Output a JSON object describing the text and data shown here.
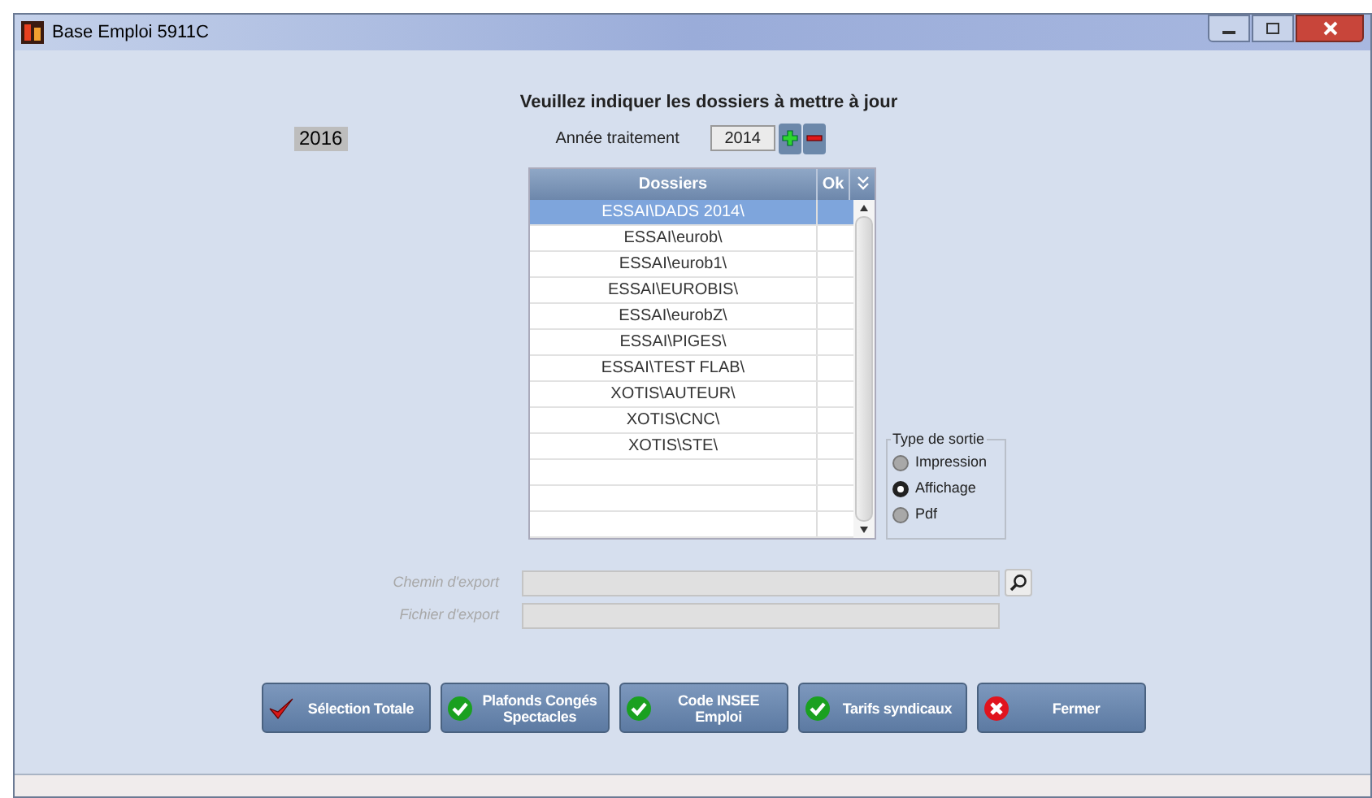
{
  "window": {
    "title": "Base Emploi 5911C"
  },
  "heading": "Veuillez indiquer les dossiers à mettre à jour",
  "year_badge": "2016",
  "year_field": {
    "label": "Année traitement",
    "value": "2014"
  },
  "table": {
    "columns": [
      "Dossiers",
      "Ok"
    ],
    "rows": [
      {
        "dossier": "ESSAI\\DADS 2014\\",
        "selected": true
      },
      {
        "dossier": "ESSAI\\eurob\\",
        "selected": false
      },
      {
        "dossier": "ESSAI\\eurob1\\",
        "selected": false
      },
      {
        "dossier": "ESSAI\\EUROBIS\\",
        "selected": false
      },
      {
        "dossier": "ESSAI\\eurobZ\\",
        "selected": false
      },
      {
        "dossier": "ESSAI\\PIGES\\",
        "selected": false
      },
      {
        "dossier": "ESSAI\\TEST FLAB\\",
        "selected": false
      },
      {
        "dossier": "XOTIS\\AUTEUR\\",
        "selected": false
      },
      {
        "dossier": "XOTIS\\CNC\\",
        "selected": false
      },
      {
        "dossier": "XOTIS\\STE\\",
        "selected": false
      }
    ]
  },
  "output_type": {
    "title": "Type de sortie",
    "options": [
      {
        "label": "Impression",
        "selected": false
      },
      {
        "label": "Affichage",
        "selected": true
      },
      {
        "label": "Pdf",
        "selected": false
      }
    ]
  },
  "fields": [
    {
      "label": "Chemin d'export",
      "search": true
    },
    {
      "label": "Fichier d'export",
      "search": false
    }
  ],
  "buttons": [
    {
      "label": "Sélection Totale",
      "kind": "tick"
    },
    {
      "label": "Plafonds Congés Spectacles",
      "kind": "check"
    },
    {
      "label": "Code INSEE Emploi",
      "kind": "check"
    },
    {
      "label": "Tarifs syndicaux",
      "kind": "check"
    },
    {
      "label": "Fermer",
      "kind": "cross"
    }
  ]
}
